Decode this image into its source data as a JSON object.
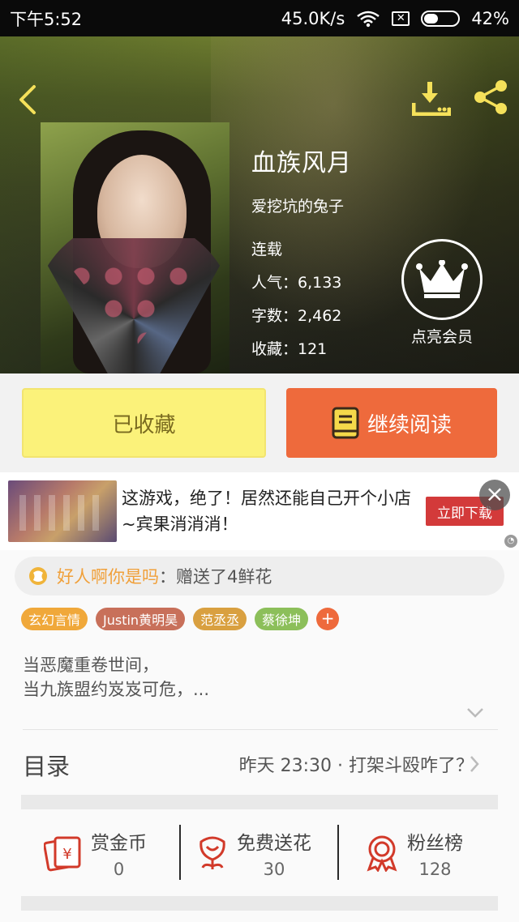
{
  "status_bar": {
    "time": "下午5:52",
    "network_speed": "45.0K/s",
    "battery_percent": "42%",
    "battery_level": 0.42
  },
  "header": {
    "back_icon": "chevron-left-icon",
    "download_icon": "download-icon",
    "share_icon": "share-icon",
    "icon_color": "#f5e15a"
  },
  "book": {
    "title": "血族风月",
    "author": "爱挖坑的兔子",
    "status": "连载",
    "popularity": "人气：6,133",
    "word_count": "字数：2,462",
    "favorites": "收藏：121"
  },
  "vip": {
    "icon": "crown-icon",
    "label": "点亮会员"
  },
  "actions": {
    "favorited_label": "已收藏",
    "continue_label": "继续阅读",
    "continue_icon": "book-icon",
    "favorited_color": "#fbf27a",
    "continue_color": "#ee6a3c"
  },
  "ad": {
    "text": "这游戏，绝了！居然还能自己开个小店~宾果消消消！",
    "button": "立即下载",
    "close_icon": "close-icon"
  },
  "gift_notice": {
    "icon": "flower-badge-icon",
    "user": "好人啊你是吗",
    "message": "：赠送了4鲜花"
  },
  "tags": [
    {
      "label": "玄幻言情",
      "color": "#f0a83a"
    },
    {
      "label": "Justin黄明昊",
      "color": "#c8705a"
    },
    {
      "label": "范丞丞",
      "color": "#d9a040"
    },
    {
      "label": "蔡徐坤",
      "color": "#8cbf5a"
    }
  ],
  "tag_add": "+",
  "synopsis": {
    "line1": "当恶魔重卷世间，",
    "line2": "当九族盟约岌岌可危，..."
  },
  "toc": {
    "label": "目录",
    "latest": "昨天 23:30 · 打架斗殴咋了？"
  },
  "bottom_stats": [
    {
      "name": "赏金币",
      "value": "0",
      "icon": "coin-envelope-icon"
    },
    {
      "name": "免费送花",
      "value": "30",
      "icon": "flower-icon"
    },
    {
      "name": "粉丝榜",
      "value": "128",
      "icon": "medal-icon"
    }
  ]
}
